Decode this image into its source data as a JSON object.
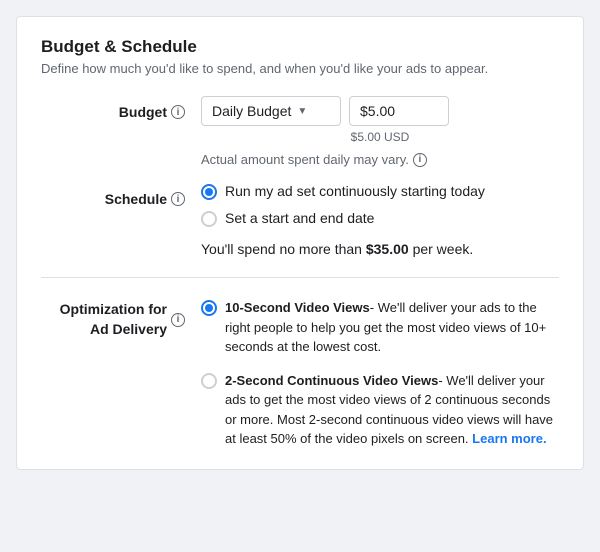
{
  "page": {
    "title": "Budget & Schedule",
    "subtitle": "Define how much you'd like to spend, and when you'd like your ads to appear."
  },
  "budget": {
    "label": "Budget",
    "select_value": "Daily Budget",
    "input_value": "$5.00",
    "usd_label": "$5.00 USD",
    "actual_amount_note": "Actual amount spent daily may vary."
  },
  "schedule": {
    "label": "Schedule",
    "option1": "Run my ad set continuously starting today",
    "option2": "Set a start and end date",
    "weekly_spend": "You'll spend no more than",
    "weekly_amount": "$35.00",
    "weekly_unit": "per week."
  },
  "optimization": {
    "label": "Optimization for Ad Delivery",
    "option1_title": "10-Second Video Views",
    "option1_desc": "- We'll deliver your ads to the right people to help you get the most video views of 10+ seconds at the lowest cost.",
    "option2_title": "2-Second Continuous Video Views",
    "option2_desc": "- We'll deliver your ads to get the most video views of 2 continuous seconds or more. Most 2-second continuous video views will have at least 50% of the video pixels on screen.",
    "learn_more": "Learn more.",
    "learn_more_url": "#"
  }
}
